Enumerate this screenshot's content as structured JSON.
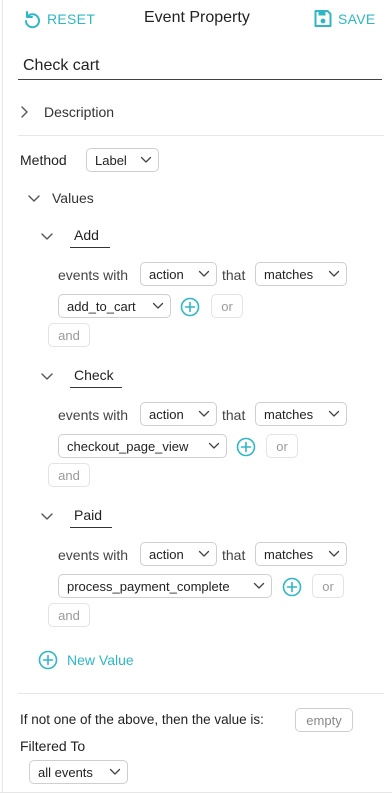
{
  "header": {
    "reset_label": "RESET",
    "title": "Event Property",
    "save_label": "SAVE"
  },
  "property_name": "Check cart",
  "description": {
    "label": "Description"
  },
  "method": {
    "label": "Method",
    "selected": "Label"
  },
  "values_section": {
    "label": "Values"
  },
  "values": [
    {
      "name": "Add",
      "events_with": "events with",
      "field": "action",
      "that": "that",
      "operator": "matches",
      "value": "add_to_cart",
      "or_label": "or",
      "and_label": "and"
    },
    {
      "name": "Check",
      "events_with": "events with",
      "field": "action",
      "that": "that",
      "operator": "matches",
      "value": "checkout_page_view",
      "or_label": "or",
      "and_label": "and"
    },
    {
      "name": "Paid",
      "events_with": "events with",
      "field": "action",
      "that": "that",
      "operator": "matches",
      "value": "process_payment_complete",
      "or_label": "or",
      "and_label": "and"
    }
  ],
  "new_value_label": "New Value",
  "fallback": {
    "text": "If not one of the above, then the value is:",
    "value": "empty"
  },
  "filtered_to": {
    "label": "Filtered To",
    "selected": "all events"
  },
  "colors": {
    "accent": "#2fb7c6",
    "text": "#222222",
    "border": "#cfcfcf",
    "muted": "#9a9a9a"
  },
  "icons": [
    "undo-icon",
    "save-icon",
    "chevron-right-icon",
    "chevron-down-icon",
    "plus-circle-icon"
  ]
}
